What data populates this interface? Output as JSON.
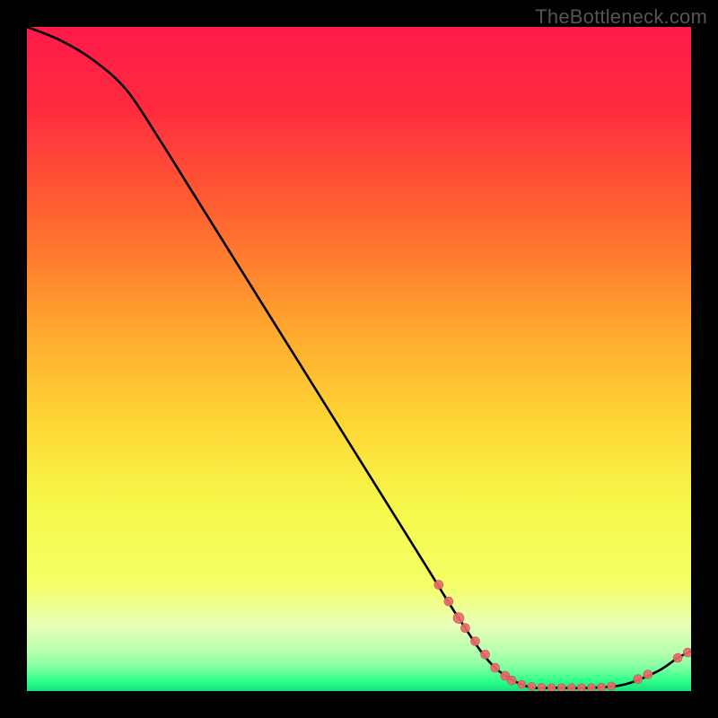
{
  "watermark": "TheBottleneck.com",
  "colors": {
    "background": "#000000",
    "gradient_top": "#ff1a4a",
    "gradient_mid_upper": "#ff7a33",
    "gradient_mid": "#ffd233",
    "gradient_mid_lower": "#f5ff66",
    "gradient_low": "#d6ffb0",
    "gradient_bottom": "#2cff8a",
    "curve": "#000000",
    "marker_fill": "#e86a6a",
    "marker_stroke": "#c94f4f"
  },
  "chart_data": {
    "type": "line",
    "title": "",
    "xlabel": "",
    "ylabel": "",
    "xlim": [
      0,
      100
    ],
    "ylim": [
      0,
      100
    ],
    "curve": [
      {
        "x": 0,
        "y": 100
      },
      {
        "x": 5,
        "y": 98
      },
      {
        "x": 10,
        "y": 95
      },
      {
        "x": 15,
        "y": 90.5
      },
      {
        "x": 20,
        "y": 83
      },
      {
        "x": 25,
        "y": 75
      },
      {
        "x": 30,
        "y": 67
      },
      {
        "x": 35,
        "y": 59
      },
      {
        "x": 40,
        "y": 51
      },
      {
        "x": 45,
        "y": 43
      },
      {
        "x": 50,
        "y": 35
      },
      {
        "x": 55,
        "y": 27
      },
      {
        "x": 60,
        "y": 19
      },
      {
        "x": 65,
        "y": 11
      },
      {
        "x": 70,
        "y": 4
      },
      {
        "x": 75,
        "y": 0.8
      },
      {
        "x": 80,
        "y": 0.5
      },
      {
        "x": 85,
        "y": 0.5
      },
      {
        "x": 90,
        "y": 1
      },
      {
        "x": 95,
        "y": 3
      },
      {
        "x": 98,
        "y": 5
      },
      {
        "x": 100,
        "y": 6
      }
    ],
    "markers": [
      {
        "x": 62,
        "y": 16,
        "r": 5
      },
      {
        "x": 63.5,
        "y": 13.5,
        "r": 5
      },
      {
        "x": 65,
        "y": 11,
        "r": 6
      },
      {
        "x": 66,
        "y": 9.5,
        "r": 5
      },
      {
        "x": 67.5,
        "y": 7.5,
        "r": 5
      },
      {
        "x": 69,
        "y": 5.5,
        "r": 5
      },
      {
        "x": 70.5,
        "y": 3.5,
        "r": 5
      },
      {
        "x": 72,
        "y": 2.3,
        "r": 5
      },
      {
        "x": 73,
        "y": 1.6,
        "r": 5
      },
      {
        "x": 74.5,
        "y": 1,
        "r": 4.5
      },
      {
        "x": 76,
        "y": 0.7,
        "r": 4.5
      },
      {
        "x": 77.5,
        "y": 0.55,
        "r": 4.5
      },
      {
        "x": 79,
        "y": 0.5,
        "r": 4.5
      },
      {
        "x": 80.5,
        "y": 0.5,
        "r": 4.5
      },
      {
        "x": 82,
        "y": 0.5,
        "r": 4.5
      },
      {
        "x": 83.5,
        "y": 0.5,
        "r": 4.5
      },
      {
        "x": 85,
        "y": 0.5,
        "r": 4.5
      },
      {
        "x": 86.5,
        "y": 0.6,
        "r": 4.5
      },
      {
        "x": 88,
        "y": 0.75,
        "r": 4.5
      },
      {
        "x": 92,
        "y": 1.8,
        "r": 5
      },
      {
        "x": 93.5,
        "y": 2.5,
        "r": 5
      },
      {
        "x": 98,
        "y": 5,
        "r": 5
      },
      {
        "x": 99.5,
        "y": 5.8,
        "r": 5
      }
    ]
  }
}
